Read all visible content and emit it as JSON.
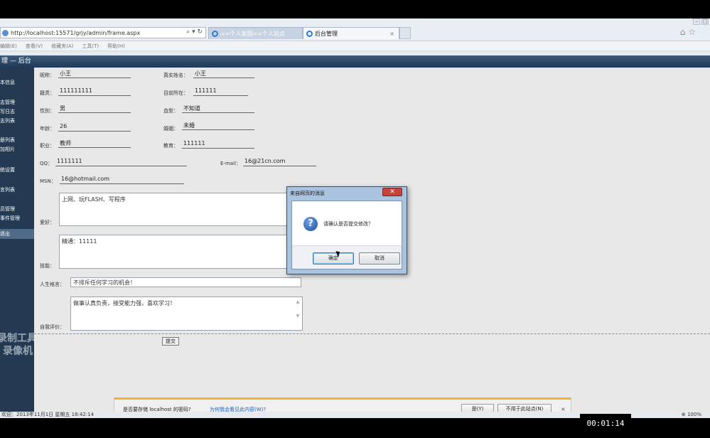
{
  "browser": {
    "url": "http://localhost:15571/grjy/admin/frame.aspx",
    "tabs": [
      {
        "label": "==个人家园==个人站点"
      },
      {
        "label": "后台管理",
        "close": "×"
      }
    ],
    "menu": [
      "编辑(E)",
      "查看(V)",
      "收藏夹(A)",
      "工具(T)",
      "帮助(H)"
    ],
    "window_controls": [
      "–",
      "□"
    ]
  },
  "site": {
    "header": "理 — 后台"
  },
  "sidebar": {
    "items": [
      "本信息",
      "志管理",
      "写日志",
      "志列表",
      "册列表",
      "加相片",
      "统设置",
      "言列表",
      "员管理",
      "事件管理",
      "退出"
    ],
    "watermark_line1": "录制工具",
    "watermark_line2": "录像机"
  },
  "form": {
    "nickname_label": "昵称：",
    "nickname": "小王",
    "realname_label": "真实姓名：",
    "realname": "小王",
    "native_label": "籍贯：",
    "native": "111111111",
    "location_label": "目前所在：",
    "location": "111111",
    "gender_label": "性别：",
    "gender": "男",
    "blood_label": "血型：",
    "blood": "不知道",
    "age_label": "年龄：",
    "age": "26",
    "marriage_label": "婚姻：",
    "marriage": "未婚",
    "job_label": "职业：",
    "job": "教师",
    "education_label": "教育：",
    "education": "111111",
    "qq_label": "QQ：",
    "qq": "1111111",
    "email_label": "E-mail：",
    "email": "16@21cn.com",
    "msn_label": "MSN：",
    "msn": "16@hotmail.com",
    "hobby_label": "爱好：",
    "hobby": "上网、玩FLASH、写程序",
    "skill_label": "技能：",
    "skill": "精通：11111",
    "motto_label": "人生格言：",
    "motto": "不排斥任何学习的机会！",
    "self_label": "自我评价：",
    "self": "做事认真负责，接受能力强，喜欢学习！",
    "submit": "提交"
  },
  "dialog": {
    "title": "来自网页的消息",
    "close": "✕",
    "icon": "question-icon",
    "message": "请确认是否提交修改？",
    "ok": "确定",
    "cancel": "取消"
  },
  "notification": {
    "question": "是否要存储 localhost 的密码?",
    "link": "为何我会看见此内容(W)?",
    "yes": "是(Y)",
    "never": "不用于此站点(N)",
    "close": "×"
  },
  "statusbar": {
    "text": "欢迎：2013年11月1日 星期五  18:42:14",
    "zoom": "⊕ 100%"
  },
  "recorder": {
    "time": "00:01:14"
  }
}
